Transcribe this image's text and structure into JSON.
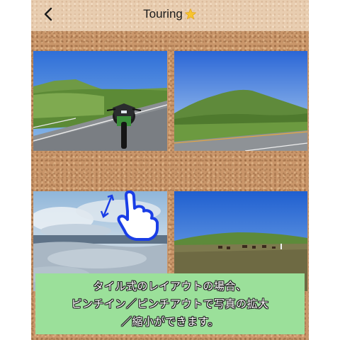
{
  "header": {
    "title": "Touring",
    "title_emoji": "⭐",
    "back_icon": "chevron-left-icon"
  },
  "tiles": [
    {
      "name": "photo-motorcycle-road"
    },
    {
      "name": "photo-mountain-road"
    },
    {
      "name": "photo-cloud-sea"
    },
    {
      "name": "photo-horses-grassland"
    }
  ],
  "gesture": {
    "icon": "pinch-hand-icon",
    "color": "#1a3ee6"
  },
  "caption": {
    "lines": [
      "タイル式のレイアウトの場合、",
      "ピンチイン／ピンチアウトで写真の拡大",
      "／縮小ができます。"
    ],
    "background": "#9be09a"
  },
  "colors": {
    "cork": "#c9966a",
    "header": "#e8cdb0"
  }
}
